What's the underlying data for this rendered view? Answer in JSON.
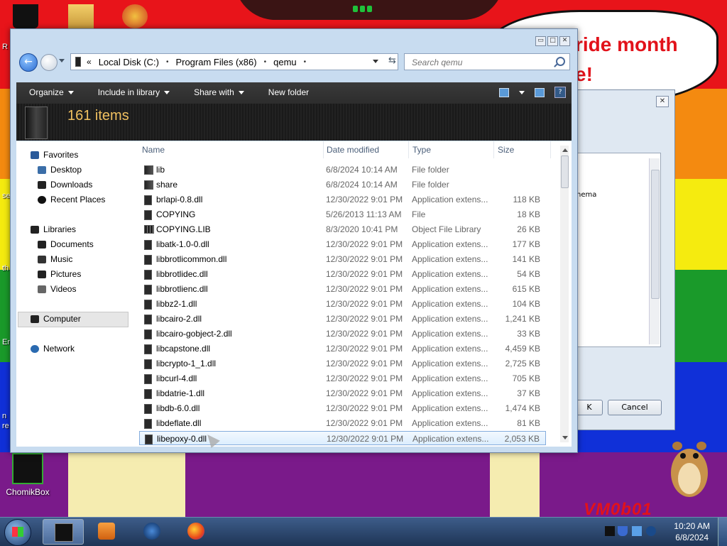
{
  "desktop": {
    "bubble_text_line1": "ride month",
    "bubble_text_line2": "e!",
    "graffiti": "VM0b01",
    "icon_label": "ChomikBox",
    "edge_texts": [
      "R",
      "se",
      "th",
      "Er",
      "n",
      "re"
    ],
    "colors": {
      "red": "#e8141a",
      "orange": "#f48a10",
      "yellow": "#f5eb0f",
      "green": "#1a9a2a",
      "blue": "#1030d8",
      "purple": "#7a1a8a"
    }
  },
  "bg_dialog": {
    "partial_text": "nema",
    "ok_label": "K",
    "cancel_label": "Cancel",
    "close_glyph": "✕"
  },
  "explorer": {
    "controls": {
      "minimize": "▭",
      "maximize": "□",
      "close": "✕"
    },
    "address": {
      "prefix": "«",
      "crumbs": [
        "Local Disk (C:)",
        "Program Files (x86)",
        "qemu"
      ],
      "separator": "•"
    },
    "search": {
      "placeholder": "Search qemu"
    },
    "toolbar": {
      "organize": "Organize",
      "include": "Include in library",
      "share": "Share with",
      "newfolder": "New folder"
    },
    "summary": "161 items",
    "nav": {
      "favorites": "Favorites",
      "desktop": "Desktop",
      "downloads": "Downloads",
      "recent": "Recent Places",
      "libraries": "Libraries",
      "documents": "Documents",
      "music": "Music",
      "pictures": "Pictures",
      "videos": "Videos",
      "computer": "Computer",
      "network": "Network"
    },
    "columns": {
      "name": "Name",
      "date": "Date modified",
      "type": "Type",
      "size": "Size"
    },
    "rows": [
      {
        "name": "lib",
        "date": "6/8/2024 10:14 AM",
        "type": "File folder",
        "size": ""
      },
      {
        "name": "share",
        "date": "6/8/2024 10:14 AM",
        "type": "File folder",
        "size": ""
      },
      {
        "name": "brlapi-0.8.dll",
        "date": "12/30/2022 9:01 PM",
        "type": "Application extens...",
        "size": "118 KB"
      },
      {
        "name": "COPYING",
        "date": "5/26/2013 11:13 AM",
        "type": "File",
        "size": "18 KB"
      },
      {
        "name": "COPYING.LIB",
        "date": "8/3/2020 10:41 PM",
        "type": "Object File Library",
        "size": "26 KB"
      },
      {
        "name": "libatk-1.0-0.dll",
        "date": "12/30/2022 9:01 PM",
        "type": "Application extens...",
        "size": "177 KB"
      },
      {
        "name": "libbrotlicommon.dll",
        "date": "12/30/2022 9:01 PM",
        "type": "Application extens...",
        "size": "141 KB"
      },
      {
        "name": "libbrotlidec.dll",
        "date": "12/30/2022 9:01 PM",
        "type": "Application extens...",
        "size": "54 KB"
      },
      {
        "name": "libbrotlienc.dll",
        "date": "12/30/2022 9:01 PM",
        "type": "Application extens...",
        "size": "615 KB"
      },
      {
        "name": "libbz2-1.dll",
        "date": "12/30/2022 9:01 PM",
        "type": "Application extens...",
        "size": "104 KB"
      },
      {
        "name": "libcairo-2.dll",
        "date": "12/30/2022 9:01 PM",
        "type": "Application extens...",
        "size": "1,241 KB"
      },
      {
        "name": "libcairo-gobject-2.dll",
        "date": "12/30/2022 9:01 PM",
        "type": "Application extens...",
        "size": "33 KB"
      },
      {
        "name": "libcapstone.dll",
        "date": "12/30/2022 9:01 PM",
        "type": "Application extens...",
        "size": "4,459 KB"
      },
      {
        "name": "libcrypto-1_1.dll",
        "date": "12/30/2022 9:01 PM",
        "type": "Application extens...",
        "size": "2,725 KB"
      },
      {
        "name": "libcurl-4.dll",
        "date": "12/30/2022 9:01 PM",
        "type": "Application extens...",
        "size": "705 KB"
      },
      {
        "name": "libdatrie-1.dll",
        "date": "12/30/2022 9:01 PM",
        "type": "Application extens...",
        "size": "37 KB"
      },
      {
        "name": "libdb-6.0.dll",
        "date": "12/30/2022 9:01 PM",
        "type": "Application extens...",
        "size": "1,474 KB"
      },
      {
        "name": "libdeflate.dll",
        "date": "12/30/2022 9:01 PM",
        "type": "Application extens...",
        "size": "81 KB"
      },
      {
        "name": "libepoxy-0.dll",
        "date": "12/30/2022 9:01 PM",
        "type": "Application extens...",
        "size": "2,053 KB"
      }
    ]
  },
  "taskbar": {
    "time": "10:20 AM",
    "date": "6/8/2024"
  }
}
